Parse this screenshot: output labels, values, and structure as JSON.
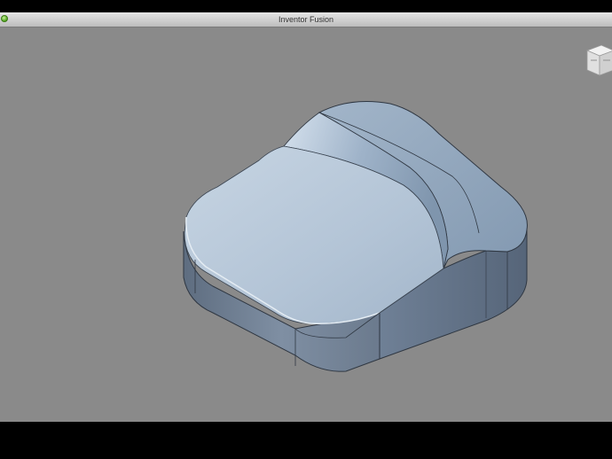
{
  "window": {
    "title": "Inventor Fusion"
  },
  "icons": {
    "traffic_light": "green-zoom-icon",
    "view_cube": "viewcube-icon"
  },
  "colors": {
    "viewport_background": "#8a8a8a",
    "model_surface": "#8fa2b9",
    "model_top": "#b5c6d8"
  }
}
